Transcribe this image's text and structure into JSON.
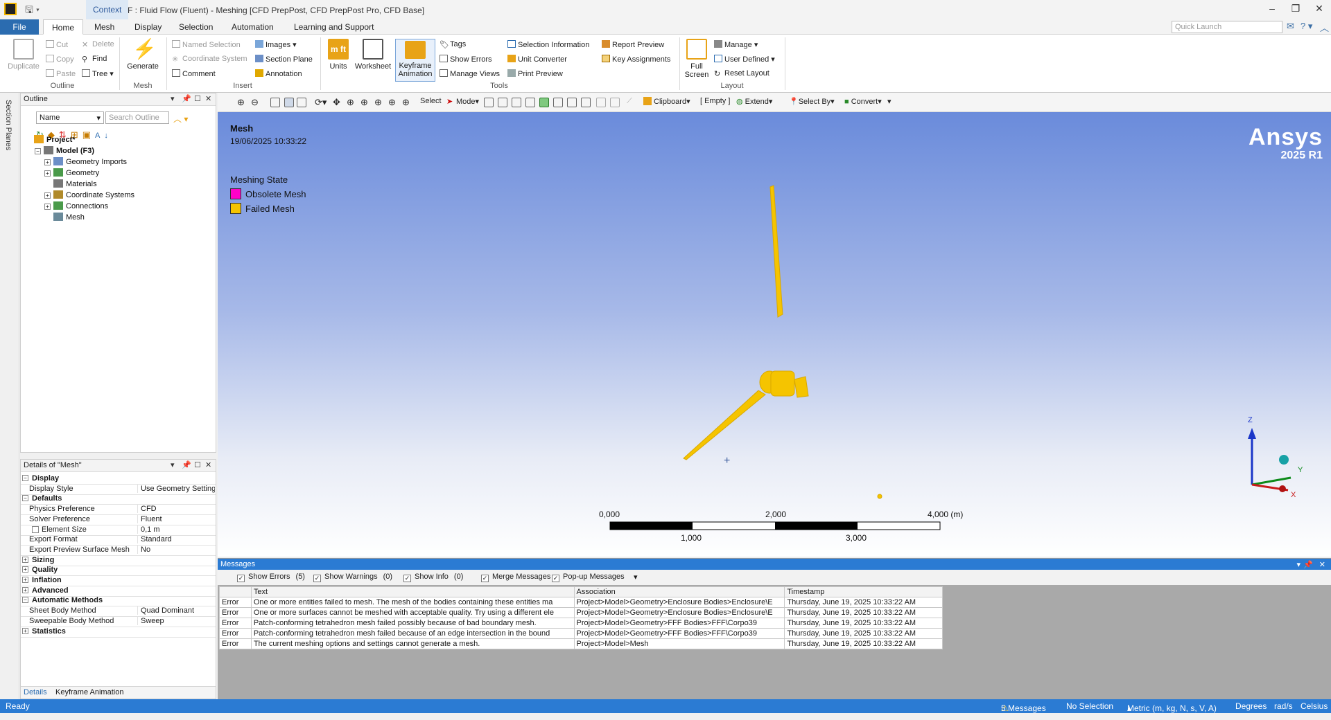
{
  "titlebar": {
    "context": "Context",
    "title": "F : Fluid Flow (Fluent) - Meshing [CFD PrepPost, CFD PrepPost Pro, CFD Base]",
    "minimize": "–",
    "restore": "❐",
    "close": "✕"
  },
  "tabs": [
    "File",
    "Home",
    "Mesh",
    "Display",
    "Selection",
    "Automation",
    "Learning and Support"
  ],
  "quick_launch_placeholder": "Quick Launch",
  "ribbon": {
    "outline": {
      "duplicate": "Duplicate",
      "cut": "Cut",
      "copy": "Copy",
      "paste": "Paste",
      "delete": "Delete",
      "find": "Find",
      "tree": "Tree",
      "group": "Outline"
    },
    "mesh": {
      "generate": "Generate",
      "group": "Mesh"
    },
    "insert": {
      "named_selection": "Named Selection",
      "coordinate_system": "Coordinate System",
      "comment": "Comment",
      "images": "Images",
      "section_plane": "Section Plane",
      "annotation": "Annotation",
      "group": "Insert"
    },
    "tools": {
      "units": "Units",
      "worksheet": "Worksheet",
      "keyframe1": "Keyframe",
      "keyframe2": "Animation",
      "tags": "Tags",
      "show_errors": "Show Errors",
      "manage_views": "Manage Views",
      "selection_information": "Selection Information",
      "unit_converter": "Unit Converter",
      "print_preview": "Print Preview",
      "report_preview": "Report Preview",
      "key_assignments": "Key Assignments",
      "group": "Tools"
    },
    "layout": {
      "full1": "Full",
      "full2": "Screen",
      "manage": "Manage",
      "user_defined": "User Defined",
      "reset_layout": "Reset Layout",
      "group": "Layout"
    }
  },
  "side_strip": "Section Planes",
  "outline": {
    "title": "Outline",
    "name_select": "Name",
    "search_placeholder": "Search Outline",
    "tree": [
      {
        "label": "Project*",
        "level": 0
      },
      {
        "label": "Model (F3)",
        "level": 1
      },
      {
        "label": "Geometry Imports",
        "level": 2
      },
      {
        "label": "Geometry",
        "level": 2
      },
      {
        "label": "Materials",
        "level": 2
      },
      {
        "label": "Coordinate Systems",
        "level": 2
      },
      {
        "label": "Connections",
        "level": 2
      },
      {
        "label": "Mesh",
        "level": 2
      }
    ]
  },
  "details": {
    "title": "Details of \"Mesh\"",
    "rows": [
      {
        "label": "Display",
        "value": "",
        "cat": true,
        "exp": "−"
      },
      {
        "label": "Display Style",
        "value": "Use Geometry Setting"
      },
      {
        "label": "Defaults",
        "value": "",
        "cat": true,
        "exp": "−"
      },
      {
        "label": "Physics Preference",
        "value": "CFD"
      },
      {
        "label": "Solver Preference",
        "value": "Fluent"
      },
      {
        "label": "Element Size",
        "value": "0,1 m"
      },
      {
        "label": "Export Format",
        "value": "Standard"
      },
      {
        "label": "Export Preview Surface Mesh",
        "value": "No"
      },
      {
        "label": "Sizing",
        "value": "",
        "cat": true,
        "exp": "+"
      },
      {
        "label": "Quality",
        "value": "",
        "cat": true,
        "exp": "+"
      },
      {
        "label": "Inflation",
        "value": "",
        "cat": true,
        "exp": "+"
      },
      {
        "label": "Advanced",
        "value": "",
        "cat": true,
        "exp": "+"
      },
      {
        "label": "Automatic Methods",
        "value": "",
        "cat": true,
        "exp": "−"
      },
      {
        "label": "Sheet Body Method",
        "value": "Quad Dominant"
      },
      {
        "label": "Sweepable Body Method",
        "value": "Sweep"
      },
      {
        "label": "Statistics",
        "value": "",
        "cat": true,
        "exp": "+"
      }
    ],
    "tabs": [
      "Details",
      "Keyframe Animation"
    ]
  },
  "view_toolbar": {
    "select": "Select",
    "mode": "Mode",
    "clipboard": "Clipboard",
    "empty": "[ Empty ]",
    "extend": "Extend",
    "select_by": "Select By",
    "convert": "Convert"
  },
  "viewport": {
    "title": "Mesh",
    "date": "19/06/2025 10:33:22",
    "state_title": "Meshing State",
    "legend": [
      {
        "label": "Obsolete Mesh",
        "color": "#ff00c8"
      },
      {
        "label": "Failed Mesh",
        "color": "#f5c400"
      }
    ],
    "brand": "Ansys",
    "version": "2025 R1",
    "scale_top": [
      "0,000",
      "2,000",
      "4,000 (m)"
    ],
    "scale_bottom": [
      "1,000",
      "3,000"
    ],
    "axes": {
      "x": "X",
      "y": "Y",
      "z": "Z"
    },
    "geometry_color": "#f5c400"
  },
  "messages": {
    "title": "Messages",
    "filters": [
      {
        "label": "Show Errors",
        "count": "(5)"
      },
      {
        "label": "Show Warnings",
        "count": "(0)"
      },
      {
        "label": "Show Info",
        "count": "(0)"
      },
      {
        "label": "Merge Messages",
        "count": ""
      },
      {
        "label": "Pop-up Messages",
        "count": ""
      }
    ],
    "columns": [
      "",
      "Text",
      "Association",
      "Timestamp"
    ],
    "rows": [
      [
        "Error",
        "One or more entities failed to mesh. The mesh of the bodies containing these entities ma",
        "Project>Model>Geometry>Enclosure Bodies>Enclosure\\E",
        "Thursday, June 19, 2025 10:33:22 AM"
      ],
      [
        "Error",
        "One or more surfaces cannot be meshed with acceptable quality. Try using a different ele",
        "Project>Model>Geometry>Enclosure Bodies>Enclosure\\E",
        "Thursday, June 19, 2025 10:33:22 AM"
      ],
      [
        "Error",
        "Patch-conforming tetrahedron mesh failed possibly because of bad boundary mesh.",
        "Project>Model>Geometry>FFF Bodies>FFF\\Corpo39",
        "Thursday, June 19, 2025 10:33:22 AM"
      ],
      [
        "Error",
        "Patch-conforming tetrahedron mesh failed because of an edge intersection in the bound",
        "Project>Model>Geometry>FFF Bodies>FFF\\Corpo39",
        "Thursday, June 19, 2025 10:33:22 AM"
      ],
      [
        "Error",
        "The current meshing options and settings cannot generate a mesh.",
        "Project>Model>Mesh",
        "Thursday, June 19, 2025 10:33:22 AM"
      ]
    ]
  },
  "status": {
    "ready": "Ready",
    "messages": "5 Messages",
    "selection": "No Selection",
    "units": "Metric (m, kg, N, s, V, A)",
    "degrees": "Degrees",
    "rads": "rad/s",
    "celsius": "Celsius"
  }
}
